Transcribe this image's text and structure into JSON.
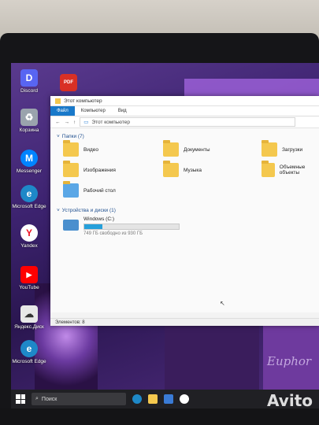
{
  "desktop_icons": [
    {
      "label": "Discord",
      "color": "#5865f2",
      "glyph": "D"
    },
    {
      "label": "Корзина",
      "color": "#9aa3ad",
      "glyph": "♻"
    },
    {
      "label": "Messenger",
      "color": "#0084ff",
      "glyph": "M"
    },
    {
      "label": "Microsoft Edge",
      "color": "#1e88c8",
      "glyph": "e"
    },
    {
      "label": "Yandex",
      "color": "#ffffff",
      "glyph": "Y"
    },
    {
      "label": "YouTube",
      "color": "#ff0000",
      "glyph": "▶"
    },
    {
      "label": "Яндекс.Диск",
      "color": "#e8e8e8",
      "glyph": "☁"
    },
    {
      "label": "Microsoft Edge",
      "color": "#1e88c8",
      "glyph": "e"
    }
  ],
  "desktop_pdf": {
    "label": "PDF"
  },
  "window": {
    "title": "Этот компьютер",
    "tabs": [
      "Файл",
      "Компьютер",
      "Вид"
    ],
    "address": "Этот компьютер",
    "folders_header": "Папки (7)",
    "folders": [
      "Видео",
      "Документы",
      "Загрузки",
      "Изображения",
      "Музыка",
      "Объемные объекты",
      "Рабочий стол"
    ],
    "devices_header": "Устройства и диски (1)",
    "drive": {
      "name": "Windows (C:)",
      "free_text": "749 ГБ свободно из 930 ГБ",
      "used_fraction": 0.19
    },
    "status": "Элементов: 8"
  },
  "taskbar": {
    "search_label": "Поиск"
  },
  "decor_text": "Euphor",
  "watermark": "Avito"
}
